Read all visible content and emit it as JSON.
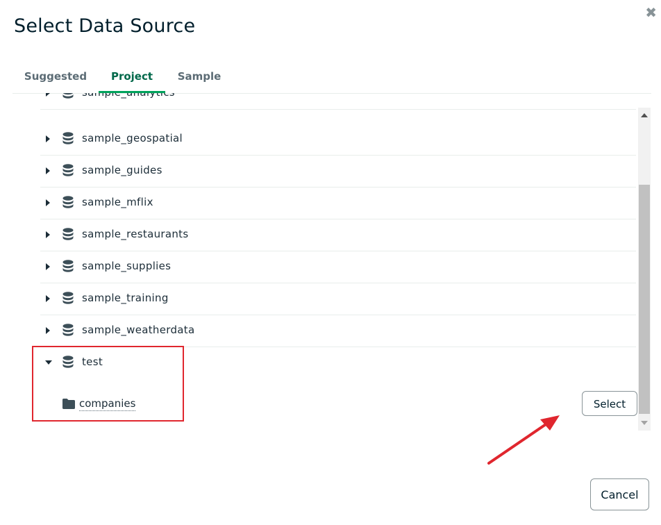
{
  "dialog": {
    "title": "Select Data Source",
    "close_glyph": "✖"
  },
  "tabs": [
    {
      "label": "Suggested",
      "active": false
    },
    {
      "label": "Project",
      "active": true
    },
    {
      "label": "Sample",
      "active": false
    }
  ],
  "databases": [
    {
      "name": "sample_analytics",
      "expanded": false
    },
    {
      "name": "sample_geospatial",
      "expanded": false
    },
    {
      "name": "sample_guides",
      "expanded": false
    },
    {
      "name": "sample_mflix",
      "expanded": false
    },
    {
      "name": "sample_restaurants",
      "expanded": false
    },
    {
      "name": "sample_supplies",
      "expanded": false
    },
    {
      "name": "sample_training",
      "expanded": false
    },
    {
      "name": "sample_weatherdata",
      "expanded": false
    },
    {
      "name": "test",
      "expanded": true
    }
  ],
  "collection": {
    "name": "companies",
    "select_label": "Select"
  },
  "footer": {
    "cancel_label": "Cancel"
  },
  "icons": {
    "database": "database-icon",
    "folder": "folder-icon",
    "caret": "caret-icon"
  },
  "colors": {
    "accent_green": "#00684a",
    "tab_underline": "#00a35c",
    "annotation_red": "#e0262e",
    "text_dark": "#1c2d38"
  }
}
